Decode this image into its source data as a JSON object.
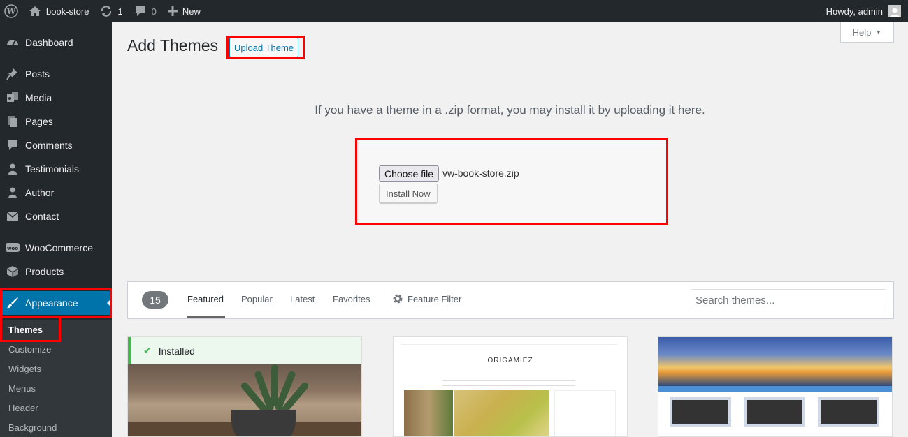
{
  "admin_bar": {
    "site_name": "book-store",
    "updates_count": "1",
    "comments_count": "0",
    "new_label": "New",
    "greeting": "Howdy, admin"
  },
  "sidebar": {
    "items": [
      {
        "label": "Dashboard",
        "icon": "dashboard-icon"
      },
      {
        "label": "Posts",
        "icon": "pin-icon"
      },
      {
        "label": "Media",
        "icon": "media-icon"
      },
      {
        "label": "Pages",
        "icon": "pages-icon"
      },
      {
        "label": "Comments",
        "icon": "comment-icon"
      },
      {
        "label": "Testimonials",
        "icon": "person-icon"
      },
      {
        "label": "Author",
        "icon": "person-icon"
      },
      {
        "label": "Contact",
        "icon": "envelope-icon"
      },
      {
        "label": "WooCommerce",
        "icon": "woo-icon"
      },
      {
        "label": "Products",
        "icon": "box-icon"
      },
      {
        "label": "Appearance",
        "icon": "brush-icon"
      }
    ],
    "submenu": [
      "Themes",
      "Customize",
      "Widgets",
      "Menus",
      "Header",
      "Background"
    ],
    "active_color": "#0073aa"
  },
  "help_tab": "Help",
  "page": {
    "title": "Add Themes",
    "upload_button": "Upload Theme",
    "help_text": "If you have a theme in a .zip format, you may install it by uploading it here."
  },
  "upload": {
    "choose_label": "Choose file",
    "file_name": "vw-book-store.zip",
    "install_label": "Install Now"
  },
  "filter": {
    "count": "15",
    "tabs": [
      "Featured",
      "Popular",
      "Latest",
      "Favorites"
    ],
    "feature_filter": "Feature Filter",
    "search_placeholder": "Search themes..."
  },
  "themes": {
    "installed_label": "Installed",
    "origamiez_logo": "ORIGAMIEZ"
  }
}
